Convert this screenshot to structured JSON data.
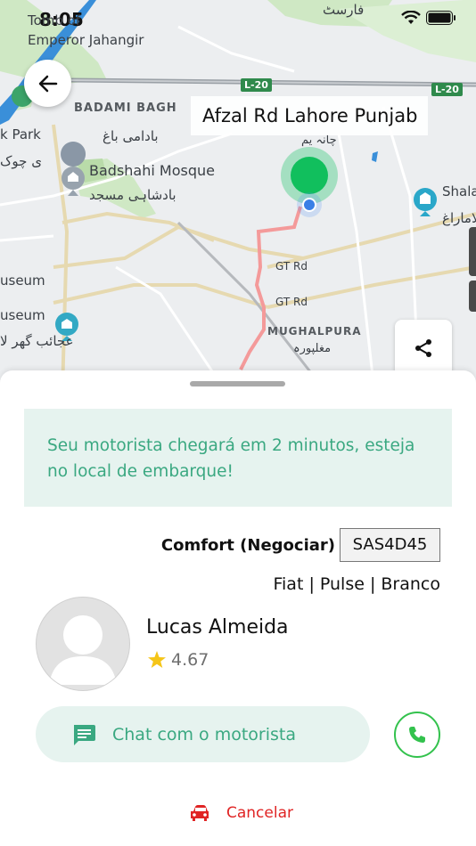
{
  "status_bar": {
    "time": "8:05"
  },
  "map": {
    "labels": {
      "tomb": "Tomb of",
      "emperor": "Emperor Jahangir",
      "badami_bagh": "BADAMI BAGH",
      "badami_bagh_urdu": "بادامی باغ",
      "park": "k Park",
      "chowk_urdu": "ی چوک",
      "badshahi": "Badshahi Mosque",
      "badshahi_urdu": "بادشاہی مسجد",
      "museum1": "useum",
      "museum2": "useum",
      "museum_urdu": "عجائب گھر لا",
      "shala": "Shala",
      "shala_urdu": "لاماراغ",
      "gt1": "GT Rd",
      "gt2": "GT Rd",
      "mughalpura": "MUGHALPURA",
      "mughalpura_urdu": "مغلپورہ",
      "chamra_urdu": "چانہ یم",
      "top_urdu": "فارسٹ",
      "l20a": "L-20",
      "l20b": "L-20"
    },
    "address": "Afzal Rd  Lahore Punjab"
  },
  "sheet": {
    "notice": "Seu motorista chegará em 2 minutos, esteja no local de embarque!",
    "ride_category": "Comfort (Negociar)",
    "plate": "SAS4D45",
    "car": "Fiat | Pulse | Branco",
    "driver_name": "Lucas Almeida",
    "rating": "4.67",
    "chat_label": "Chat com o motorista",
    "cancel_label": "Cancelar"
  },
  "colors": {
    "accent_green": "#3aa881",
    "call_green": "#33c24d",
    "cancel_red": "#e02424",
    "route": "#f49a9a",
    "marker": "#1fc46a"
  }
}
